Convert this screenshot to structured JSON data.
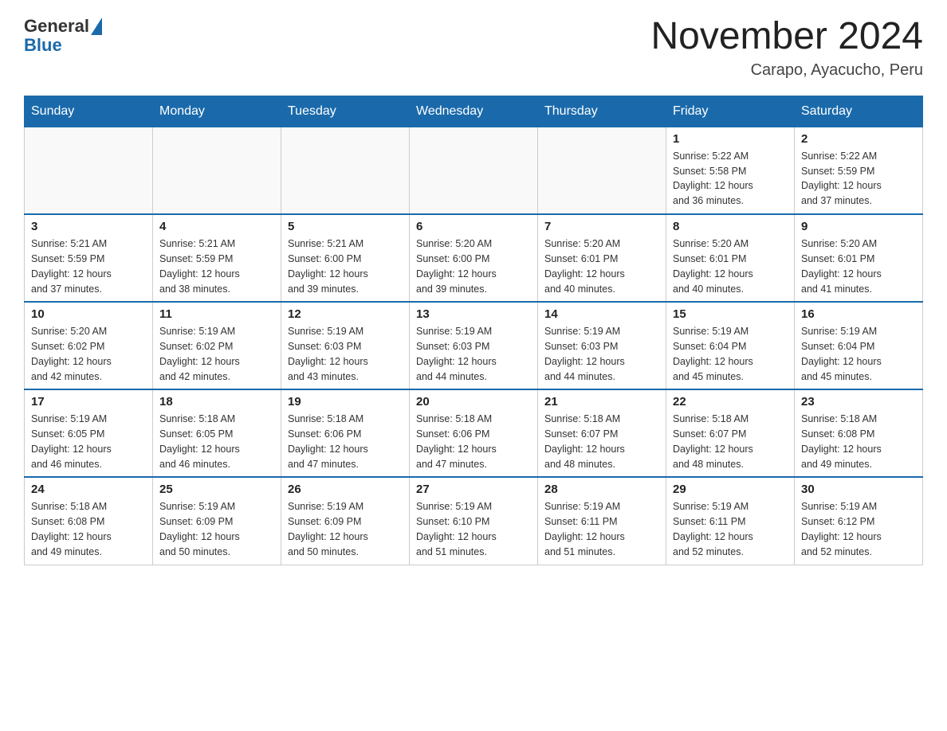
{
  "header": {
    "logo_text": "General",
    "logo_blue": "Blue",
    "title": "November 2024",
    "subtitle": "Carapo, Ayacucho, Peru"
  },
  "weekdays": [
    "Sunday",
    "Monday",
    "Tuesday",
    "Wednesday",
    "Thursday",
    "Friday",
    "Saturday"
  ],
  "weeks": [
    [
      {
        "day": "",
        "info": ""
      },
      {
        "day": "",
        "info": ""
      },
      {
        "day": "",
        "info": ""
      },
      {
        "day": "",
        "info": ""
      },
      {
        "day": "",
        "info": ""
      },
      {
        "day": "1",
        "info": "Sunrise: 5:22 AM\nSunset: 5:58 PM\nDaylight: 12 hours\nand 36 minutes."
      },
      {
        "day": "2",
        "info": "Sunrise: 5:22 AM\nSunset: 5:59 PM\nDaylight: 12 hours\nand 37 minutes."
      }
    ],
    [
      {
        "day": "3",
        "info": "Sunrise: 5:21 AM\nSunset: 5:59 PM\nDaylight: 12 hours\nand 37 minutes."
      },
      {
        "day": "4",
        "info": "Sunrise: 5:21 AM\nSunset: 5:59 PM\nDaylight: 12 hours\nand 38 minutes."
      },
      {
        "day": "5",
        "info": "Sunrise: 5:21 AM\nSunset: 6:00 PM\nDaylight: 12 hours\nand 39 minutes."
      },
      {
        "day": "6",
        "info": "Sunrise: 5:20 AM\nSunset: 6:00 PM\nDaylight: 12 hours\nand 39 minutes."
      },
      {
        "day": "7",
        "info": "Sunrise: 5:20 AM\nSunset: 6:01 PM\nDaylight: 12 hours\nand 40 minutes."
      },
      {
        "day": "8",
        "info": "Sunrise: 5:20 AM\nSunset: 6:01 PM\nDaylight: 12 hours\nand 40 minutes."
      },
      {
        "day": "9",
        "info": "Sunrise: 5:20 AM\nSunset: 6:01 PM\nDaylight: 12 hours\nand 41 minutes."
      }
    ],
    [
      {
        "day": "10",
        "info": "Sunrise: 5:20 AM\nSunset: 6:02 PM\nDaylight: 12 hours\nand 42 minutes."
      },
      {
        "day": "11",
        "info": "Sunrise: 5:19 AM\nSunset: 6:02 PM\nDaylight: 12 hours\nand 42 minutes."
      },
      {
        "day": "12",
        "info": "Sunrise: 5:19 AM\nSunset: 6:03 PM\nDaylight: 12 hours\nand 43 minutes."
      },
      {
        "day": "13",
        "info": "Sunrise: 5:19 AM\nSunset: 6:03 PM\nDaylight: 12 hours\nand 44 minutes."
      },
      {
        "day": "14",
        "info": "Sunrise: 5:19 AM\nSunset: 6:03 PM\nDaylight: 12 hours\nand 44 minutes."
      },
      {
        "day": "15",
        "info": "Sunrise: 5:19 AM\nSunset: 6:04 PM\nDaylight: 12 hours\nand 45 minutes."
      },
      {
        "day": "16",
        "info": "Sunrise: 5:19 AM\nSunset: 6:04 PM\nDaylight: 12 hours\nand 45 minutes."
      }
    ],
    [
      {
        "day": "17",
        "info": "Sunrise: 5:19 AM\nSunset: 6:05 PM\nDaylight: 12 hours\nand 46 minutes."
      },
      {
        "day": "18",
        "info": "Sunrise: 5:18 AM\nSunset: 6:05 PM\nDaylight: 12 hours\nand 46 minutes."
      },
      {
        "day": "19",
        "info": "Sunrise: 5:18 AM\nSunset: 6:06 PM\nDaylight: 12 hours\nand 47 minutes."
      },
      {
        "day": "20",
        "info": "Sunrise: 5:18 AM\nSunset: 6:06 PM\nDaylight: 12 hours\nand 47 minutes."
      },
      {
        "day": "21",
        "info": "Sunrise: 5:18 AM\nSunset: 6:07 PM\nDaylight: 12 hours\nand 48 minutes."
      },
      {
        "day": "22",
        "info": "Sunrise: 5:18 AM\nSunset: 6:07 PM\nDaylight: 12 hours\nand 48 minutes."
      },
      {
        "day": "23",
        "info": "Sunrise: 5:18 AM\nSunset: 6:08 PM\nDaylight: 12 hours\nand 49 minutes."
      }
    ],
    [
      {
        "day": "24",
        "info": "Sunrise: 5:18 AM\nSunset: 6:08 PM\nDaylight: 12 hours\nand 49 minutes."
      },
      {
        "day": "25",
        "info": "Sunrise: 5:19 AM\nSunset: 6:09 PM\nDaylight: 12 hours\nand 50 minutes."
      },
      {
        "day": "26",
        "info": "Sunrise: 5:19 AM\nSunset: 6:09 PM\nDaylight: 12 hours\nand 50 minutes."
      },
      {
        "day": "27",
        "info": "Sunrise: 5:19 AM\nSunset: 6:10 PM\nDaylight: 12 hours\nand 51 minutes."
      },
      {
        "day": "28",
        "info": "Sunrise: 5:19 AM\nSunset: 6:11 PM\nDaylight: 12 hours\nand 51 minutes."
      },
      {
        "day": "29",
        "info": "Sunrise: 5:19 AM\nSunset: 6:11 PM\nDaylight: 12 hours\nand 52 minutes."
      },
      {
        "day": "30",
        "info": "Sunrise: 5:19 AM\nSunset: 6:12 PM\nDaylight: 12 hours\nand 52 minutes."
      }
    ]
  ]
}
